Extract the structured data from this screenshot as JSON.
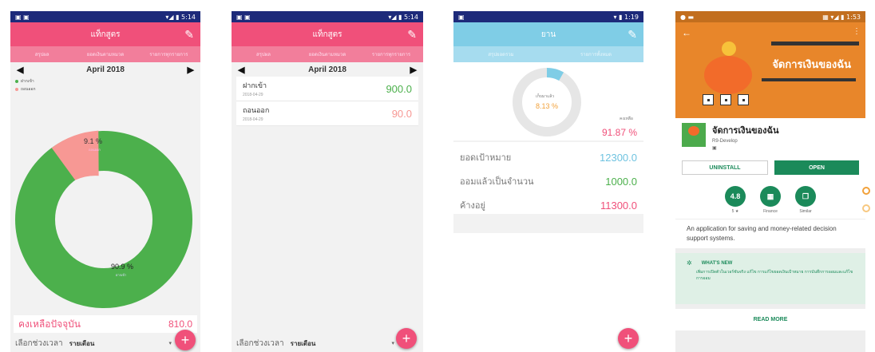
{
  "colors": {
    "pink": "#f0507a",
    "pink_tab": "#f27e9b",
    "teal": "#7fcde6",
    "teal_tab": "#a6dcef",
    "green": "#4cb04c",
    "salmon": "#f79894",
    "status_dark": "#1d2a7a",
    "play_green": "#1b8a5a"
  },
  "screen1": {
    "status_time": "5:14",
    "title": "แท็กสูตร",
    "tabs": [
      "สรุปผล",
      "ยอดเงินตามหมวด",
      "รายการทุกรายการ"
    ],
    "month": "April 2018",
    "legend": [
      "ฝากเข้า",
      "ถอนออก"
    ],
    "donut_labels": [
      {
        "percent": "90.9 %",
        "caption": "ฝากเข้า"
      },
      {
        "percent": "9.1 %",
        "caption": "ถอนออก"
      }
    ],
    "balance_label": "คงเหลือปัจจุบัน",
    "balance_value": "810.0",
    "period_label": "เลือกช่วงเวลา",
    "period_value": "รายเดือน",
    "fab": "+"
  },
  "screen2": {
    "status_time": "5:14",
    "title": "แท็กสูตร",
    "tabs": [
      "สรุปผล",
      "ยอดเงินตามหมวด",
      "รายการทุกรายการ"
    ],
    "month": "April 2018",
    "items": [
      {
        "name": "ฝากเข้า",
        "date": "2018-04-29",
        "amount": "900.0",
        "color": "#4cb04c"
      },
      {
        "name": "ถอนออก",
        "date": "2018-04-29",
        "amount": "90.0",
        "color": "#f0507a"
      }
    ],
    "period_label": "เลือกช่วงเวลา",
    "period_value": "รายเดือน",
    "fab": "+"
  },
  "screen3": {
    "status_time": "1:19",
    "title": "ยาน",
    "tabs": [
      "สรุปยอดรวม",
      "รายการทั้งหมด"
    ],
    "ring_caption": "เก็บมาแล้ว",
    "ring_percent": "8.13 %",
    "remain_caption": "คงเหลือ",
    "remain_percent": "91.87 %",
    "ring_progress": 8.13,
    "rows": [
      {
        "label": "ยอดเป้าหมาย",
        "value": "12300.0",
        "color": "#6fc3e0"
      },
      {
        "label": "ออมแล้วเป็นจำนวน",
        "value": "1000.0",
        "color": "#4cb04c"
      },
      {
        "label": "ค้างอยู่",
        "value": "11300.0",
        "color": "#f0507a"
      }
    ],
    "fab": "+"
  },
  "screen4": {
    "status_time": "1:53",
    "hero_title": "จัดการเงินของฉัน",
    "app_name": "จัดการเงินของฉัน",
    "developer": "R9-Develop",
    "uninstall": "UNINSTALL",
    "open": "OPEN",
    "rating": "4.8",
    "stat_labels": [
      "5 ★",
      "Finance",
      "Similar"
    ],
    "description": "An application for saving and money-related decision support systems.",
    "whats_new_title": "WHAT'S NEW",
    "whats_new_text": "เพิ่มการเปิดตัวในเวอร์ชันจริง แก้ไข การแก้ไขยอดเงินเป้าหมาย การบันทึกการออมและแก้ไขการออม",
    "read_more": "READ MORE"
  }
}
